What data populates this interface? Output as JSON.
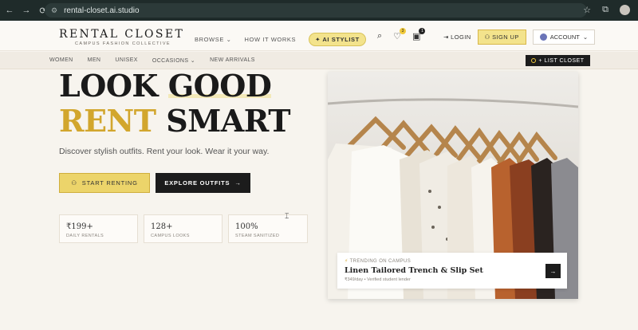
{
  "browser": {
    "url": "rental-closet.ai.studio"
  },
  "brand": {
    "name": "RENTAL CLOSET",
    "tagline": "CAMPUS FASHION COLLECTIVE"
  },
  "nav": {
    "browse": "BROWSE",
    "how_it_works": "HOW IT WORKS",
    "ai_stylist": "AI STYLIST"
  },
  "header_icons": {
    "search": "search-icon",
    "wishlist_count": "3",
    "cart_count": "1"
  },
  "auth": {
    "login": "LOGIN",
    "signup": "SIGN UP",
    "account": "ACCOUNT"
  },
  "categories": [
    "WOMEN",
    "MEN",
    "UNISEX",
    "OCCASIONS",
    "NEW ARRIVALS"
  ],
  "list_closet": "+ LIST CLOSET",
  "hero": {
    "line1_a": "LOOK",
    "line1_b": "GOOD",
    "line2_a": "RENT",
    "line2_b": "SMART",
    "subtitle": "Discover stylish outfits. Rent your look. Wear it your way.",
    "start_renting": "START RENTING",
    "explore_outfits": "EXPLORE OUTFITS"
  },
  "stats": [
    {
      "value": "₹199+",
      "label": "DAILY RENTALS"
    },
    {
      "value": "128+",
      "label": "CAMPUS LOOKS"
    },
    {
      "value": "100%",
      "label": "STEAM SANITIZED"
    }
  ],
  "featured": {
    "trending": "TRENDING ON CAMPUS",
    "title": "Linen Tailored Trench & Slip Set",
    "meta": "₹349/day • Verified student lender"
  },
  "colors": {
    "accent": "#ecd46a",
    "gold_text": "#d2a62d",
    "dark": "#1c1c1c"
  }
}
